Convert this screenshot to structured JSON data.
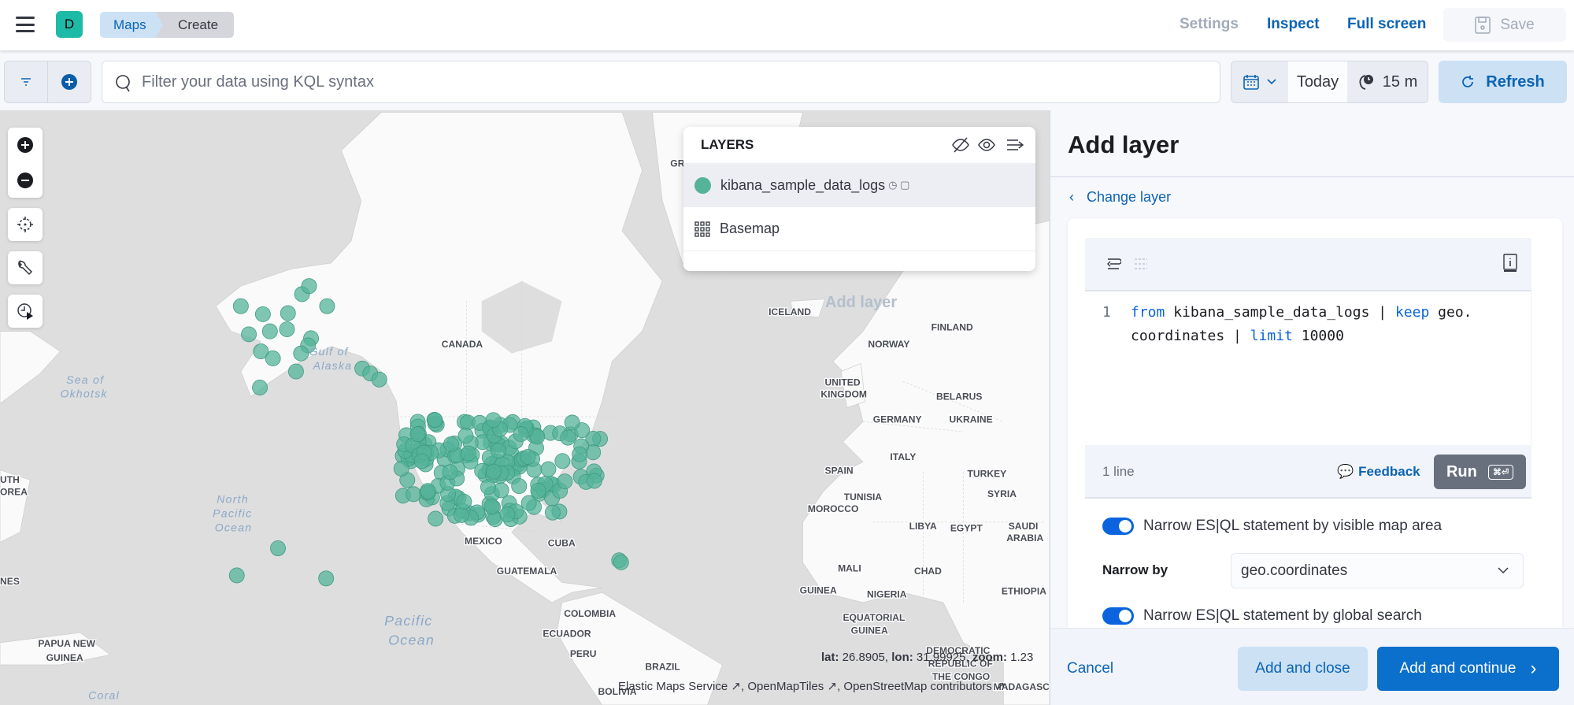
{
  "header": {
    "avatar_letter": "D",
    "breadcrumbs": [
      "Maps",
      "Create"
    ],
    "links": {
      "settings": "Settings",
      "inspect": "Inspect",
      "full_screen": "Full screen"
    },
    "save_label": "Save"
  },
  "query": {
    "placeholder": "Filter your data using KQL syntax",
    "date_label": "Today",
    "refresh_interval": "15 m",
    "refresh_label": "Refresh"
  },
  "map": {
    "marker_color": "#54b399",
    "add_layer_hint": "Add layer",
    "labels": {
      "canada": "CANADA",
      "mexico": "MEXICO",
      "cuba": "CUBA",
      "guatemala": "GUATEMALA",
      "colombia": "COLOMBIA",
      "ecuador": "ECUADOR",
      "peru": "PERU",
      "brazil": "BRAZIL",
      "bolivia": "BOLIVIA",
      "iceland": "ICELAND",
      "finland": "FINLAND",
      "norway": "NORWAY",
      "uk1": "UNITED",
      "uk2": "KINGDOM",
      "belarus": "BELARUS",
      "germany": "GERMANY",
      "ukraine": "UKRAINE",
      "italy": "ITALY",
      "turkey": "TURKEY",
      "spain": "SPAIN",
      "syria": "SYRIA",
      "tunisia": "TUNISIA",
      "morocco": "MOROCCO",
      "libya": "LIBYA",
      "egypt": "EGYPT",
      "saudi1": "SAUDI",
      "saudi2": "ARABIA",
      "mali": "MALI",
      "chad": "CHAD",
      "guinea": "GUINEA",
      "nigeria": "NIGERIA",
      "ethiopia": "ETHIOPIA",
      "eqg1": "EQUATORIAL",
      "eqg2": "GUINEA",
      "drc1": "DEMOCRATIC",
      "drc2": "REPUBLIC OF",
      "drc3": "THE CONGO",
      "madagascar": "MADAGASC",
      "png1": "PAPUA NEW",
      "png2": "GUINEA",
      "gr": "GR",
      "uth": "UTH",
      "orea": "OREA",
      "nes": "NES"
    },
    "water_labels": {
      "okhotsk1": "Sea of",
      "okhotsk2": "Okhotsk",
      "alaska1": "Gulf of",
      "alaska2": "Alaska",
      "npo1": "North",
      "npo2": "Pacific",
      "npo3": "Ocean",
      "po1": "Pacific",
      "po2": "Ocean",
      "coral": "Coral"
    },
    "readout": {
      "lat_label": "lat:",
      "lat": "26.8905,",
      "lon_label": "lon:",
      "lon": "31.99925,",
      "zoom_label": "zoom:",
      "zoom": "1.23"
    },
    "attribution": [
      "Elastic Maps Service",
      "OpenMapTiles",
      "OpenStreetMap contributors"
    ]
  },
  "layers": {
    "title": "LAYERS",
    "items": [
      {
        "name": "kibana_sample_data_logs",
        "color": "#54b399"
      },
      {
        "name": "Basemap"
      }
    ]
  },
  "panel": {
    "title": "Add layer",
    "change_layer": "Change layer",
    "editor": {
      "line_number": "1",
      "code": {
        "kw1": "from",
        "t1": " kibana_sample_data_logs | ",
        "kw2": "keep",
        "t2": " geo.",
        "t3": "coordinates | ",
        "kw3": "limit",
        "t4": " 10000"
      },
      "line_count": "1 line",
      "feedback": "Feedback",
      "run": "Run",
      "run_shortcut": "⌘⏎"
    },
    "toggle_map_area": {
      "label": "Narrow ES|QL statement by visible map area",
      "on": true
    },
    "narrow_by_label": "Narrow by",
    "narrow_by_value": "geo.coordinates",
    "toggle_global_search": {
      "label": "Narrow ES|QL statement by global search",
      "on": true
    },
    "cancel": "Cancel",
    "add_and_close": "Add and close",
    "add_and_continue": "Add and continue"
  }
}
